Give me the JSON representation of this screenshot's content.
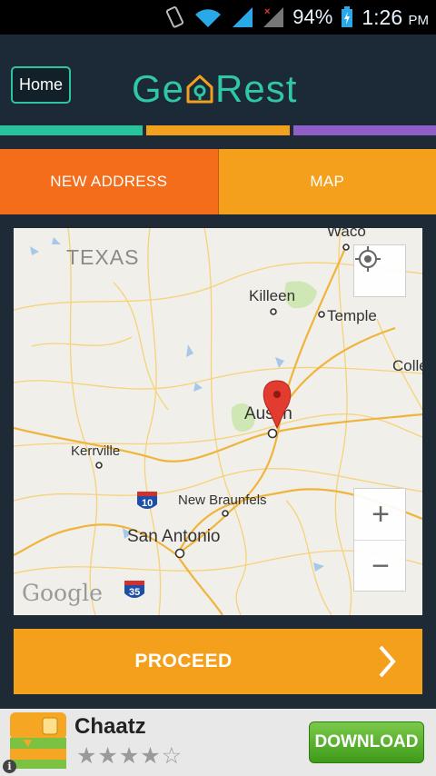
{
  "status_bar": {
    "battery": "94%",
    "time": "1:26",
    "ampm": "PM",
    "icons": [
      "vibrate-icon",
      "wifi-icon",
      "signal-icon",
      "signal-no-service-icon",
      "battery-charging-icon"
    ]
  },
  "header": {
    "home_label": "Home",
    "logo_text_left": "Ge",
    "logo_text_right": "Rest",
    "logo_colors": {
      "primary": "#2fc7a4",
      "accent": "#f2a01d"
    },
    "stripe_colors": [
      "#27c39c",
      "#f2a01d",
      "#8e5fc6"
    ]
  },
  "tabs": [
    {
      "label": "NEW ADDRESS",
      "color": "#f36d1b",
      "active": true
    },
    {
      "label": "MAP",
      "color": "#f4a01c",
      "active": false
    }
  ],
  "map": {
    "labels": {
      "state": "TEXAS",
      "waco": "Waco",
      "killeen": "Killeen",
      "temple": "Temple",
      "college": "Colle",
      "austin": "Austin",
      "kerrville": "Kerrville",
      "new_braunfels": "New Braunfels",
      "san_antonio": "San Antonio",
      "i10": "10",
      "i35": "35",
      "google": "Google"
    },
    "zoom_in": "+",
    "zoom_out": "−"
  },
  "proceed": {
    "label": "PROCEED"
  },
  "ad": {
    "title": "Chaatz",
    "rating": 4,
    "stars": "★★★★☆",
    "download_label": "DOWNLOAD",
    "info": "i"
  }
}
